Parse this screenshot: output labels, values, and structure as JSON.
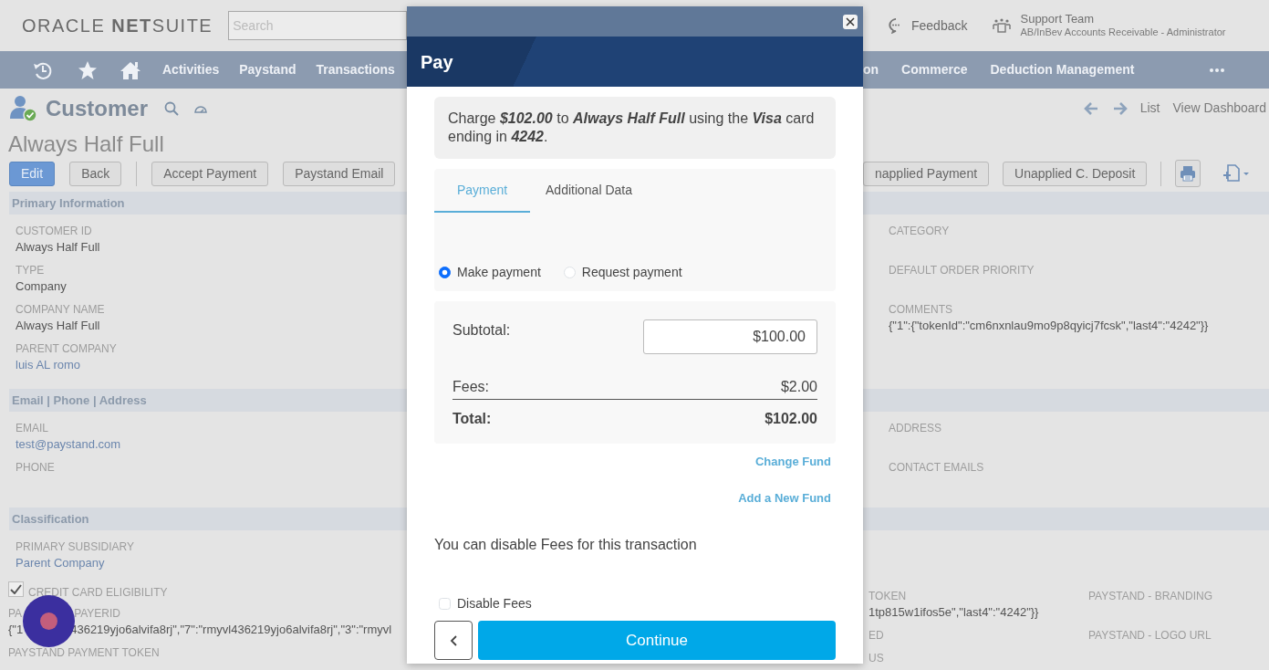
{
  "header": {
    "logo": "ORACLE **NET**SUITE",
    "search": {
      "placeholder": "Search"
    },
    "feedback": "Feedback",
    "user": {
      "name": "Support Team",
      "role": "AB/InBev Accounts Receivable - Administrator"
    }
  },
  "nav": {
    "left": [
      "Activities",
      "Paystand",
      "Transactions"
    ],
    "right": [
      "on",
      "Commerce",
      "Deduction Management"
    ]
  },
  "record": {
    "type": "Customer",
    "name": "Always Half Full",
    "links": [
      "List",
      "View Dashboard"
    ]
  },
  "button_groups": [
    [
      {
        "label": "Edit",
        "primary": true
      },
      {
        "label": "Back",
        "primary": false
      }
    ],
    [
      {
        "label": "Accept Payment",
        "primary": false
      },
      {
        "label": "Paystand Email",
        "primary": false
      }
    ]
  ],
  "buttons_right": [
    "napplied Payment",
    "Unapplied C. Deposit"
  ],
  "sections": [
    {
      "title": "Primary Information",
      "left": [
        {
          "label": "CUSTOMER ID",
          "value": "Always Half Full",
          "link": false
        },
        {
          "label": "TYPE",
          "value": "Company",
          "link": false
        },
        {
          "label": "COMPANY NAME",
          "value": "Always Half Full",
          "link": false
        },
        {
          "label": "PARENT COMPANY",
          "value": "luis AL romo",
          "link": true
        }
      ],
      "right_columns": [
        [
          {
            "label": "CATEGORY"
          },
          {
            "label": "DEFAULT ORDER PRIORITY"
          },
          {
            "label": "COMMENTS",
            "value": "{\"1\":{\"tokenId\":\"cm6nxnlau9mo9p8qyicj7fcsk\",\"last4\":\"4242\"}}",
            "link": false
          }
        ]
      ]
    },
    {
      "title": "Email | Phone | Address",
      "left": [
        {
          "label": "EMAIL",
          "value": "test@paystand.com",
          "link": true
        },
        {
          "label": "PHONE"
        }
      ],
      "right_columns": [
        [
          {
            "label": "ADDRESS"
          },
          {
            "label": "CONTACT EMAILS"
          }
        ]
      ]
    },
    {
      "title": "Classification",
      "left": [
        {
          "label": "PRIMARY SUBSIDIARY",
          "value": "Parent Company",
          "link": true
        }
      ],
      "left_more": [
        {
          "kind": "checkbox",
          "label": "CREDIT CARD ELIGIBILITY",
          "checked": true
        },
        {
          "kind": "split",
          "label_parts": [
            "PA",
            "PAYERID"
          ],
          "value_parts": [
            "{\"1",
            "436219yjo6alvifa8rj\",\"7\":\"rmyvl436219yjo6alvifa8rj\",\"3\":\"rmyvl"
          ]
        },
        {
          "kind": "field",
          "label": "PAYSTAND PAYMENT TOKEN"
        }
      ],
      "right_columns": [
        [
          {
            "label": "TOKEN",
            "value": "1tp815w1ifos5e\",\"last4\":\"4242\"}}",
            "link": false
          },
          {
            "label": "ED"
          },
          {
            "label": "US"
          }
        ],
        [
          {
            "label": "PAYSTAND - BRANDING"
          },
          {
            "label": "PAYSTAND - LOGO URL"
          }
        ]
      ]
    }
  ],
  "modal": {
    "title": "Pay",
    "charge": [
      {
        "text": "Charge ",
        "emphasis": false
      },
      {
        "text": "$102.00",
        "emphasis": true
      },
      {
        "text": " to ",
        "emphasis": false
      },
      {
        "text": "Always Half Full",
        "emphasis": true
      },
      {
        "text": " using the ",
        "emphasis": false
      },
      {
        "text": "Visa",
        "emphasis": true
      },
      {
        "text": " card ending in ",
        "emphasis": false
      },
      {
        "text": "4242",
        "emphasis": true
      },
      {
        "text": ".",
        "emphasis": false
      }
    ],
    "tabs": [
      {
        "label": "Payment",
        "selected": true
      },
      {
        "label": "Additional Data",
        "selected": false
      }
    ],
    "payment_mode": [
      {
        "label": "Make payment",
        "selected": true
      },
      {
        "label": "Request payment",
        "selected": false
      }
    ],
    "subtotal": {
      "label": "Subtotal:",
      "value": "$100.00"
    },
    "fees": {
      "label": "Fees:",
      "value": "$2.00"
    },
    "total": {
      "label": "Total:",
      "value": "$102.00"
    },
    "links": [
      "Change Fund",
      "Add a New Fund"
    ],
    "note": "You can disable Fees for this transaction",
    "disable_fees": {
      "label": "Disable Fees",
      "checked": false
    },
    "continue": "Continue"
  }
}
